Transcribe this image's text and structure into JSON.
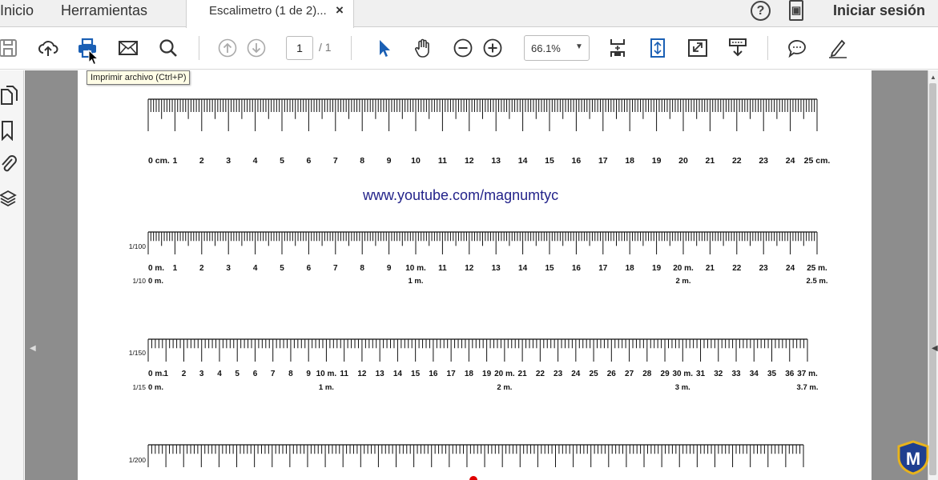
{
  "tabs": {
    "home": "Inicio",
    "tools": "Herramientas",
    "document": "Escalimetro (1 de 2)...",
    "close": "×"
  },
  "header": {
    "help": "?",
    "signin": "Iniciar sesión"
  },
  "toolbar": {
    "page_current": "1",
    "page_total": "/ 1",
    "zoom": "66.1%",
    "tooltip": "Imprimir archivo (Ctrl+P)"
  },
  "icons": [
    "save-icon",
    "upload-icon",
    "print-icon",
    "email-icon",
    "search-icon",
    "page-up-icon",
    "page-down-icon",
    "select-pointer-icon",
    "hand-icon",
    "zoom-out-icon",
    "zoom-in-icon",
    "fit-page-icon",
    "read-mode-icon",
    "fullscreen-icon",
    "scroll-mode-icon",
    "comment-icon",
    "sign-icon",
    "pages-panel-icon",
    "bookmark-icon",
    "attachment-icon",
    "layers-icon"
  ],
  "colors": {
    "accent_blue": "#1a5fb4",
    "link_color": "#23238a",
    "doc_background": "#8d8d8d"
  },
  "document": {
    "link": "www.youtube.com/magnumtyc",
    "rulers": [
      {
        "scale_label": "",
        "main_labels": [
          "0 cm.",
          "1",
          "2",
          "3",
          "4",
          "5",
          "6",
          "7",
          "8",
          "9",
          "10",
          "11",
          "12",
          "13",
          "14",
          "15",
          "16",
          "17",
          "18",
          "19",
          "20",
          "21",
          "22",
          "23",
          "24",
          "25 cm."
        ],
        "secondary_scale_label": "",
        "secondary_labels": []
      },
      {
        "scale_label": "1/100",
        "main_labels": [
          "0 m.",
          "1",
          "2",
          "3",
          "4",
          "5",
          "6",
          "7",
          "8",
          "9",
          "10 m.",
          "11",
          "12",
          "13",
          "14",
          "15",
          "16",
          "17",
          "18",
          "19",
          "20 m.",
          "21",
          "22",
          "23",
          "24",
          "25 m."
        ],
        "secondary_scale_label": "1/10",
        "secondary_labels": [
          "0 m.",
          "1 m.",
          "2 m.",
          "2.5 m."
        ]
      },
      {
        "scale_label": "1/150",
        "main_labels": [
          "0 m.",
          "1",
          "2",
          "3",
          "4",
          "5",
          "6",
          "7",
          "8",
          "9",
          "10 m.",
          "11",
          "12",
          "13",
          "14",
          "15",
          "16",
          "17",
          "18",
          "19",
          "20 m.",
          "21",
          "22",
          "23",
          "24",
          "25",
          "26",
          "27",
          "28",
          "29",
          "30 m.",
          "31",
          "32",
          "33",
          "34",
          "35",
          "36",
          "37 m."
        ],
        "secondary_scale_label": "1/15",
        "secondary_labels": [
          "0 m.",
          "1 m.",
          "2 m.",
          "3 m.",
          "3.7 m."
        ]
      },
      {
        "scale_label": "1/200",
        "main_labels": [],
        "secondary_scale_label": "",
        "secondary_labels": []
      }
    ]
  },
  "logo_text": "M"
}
